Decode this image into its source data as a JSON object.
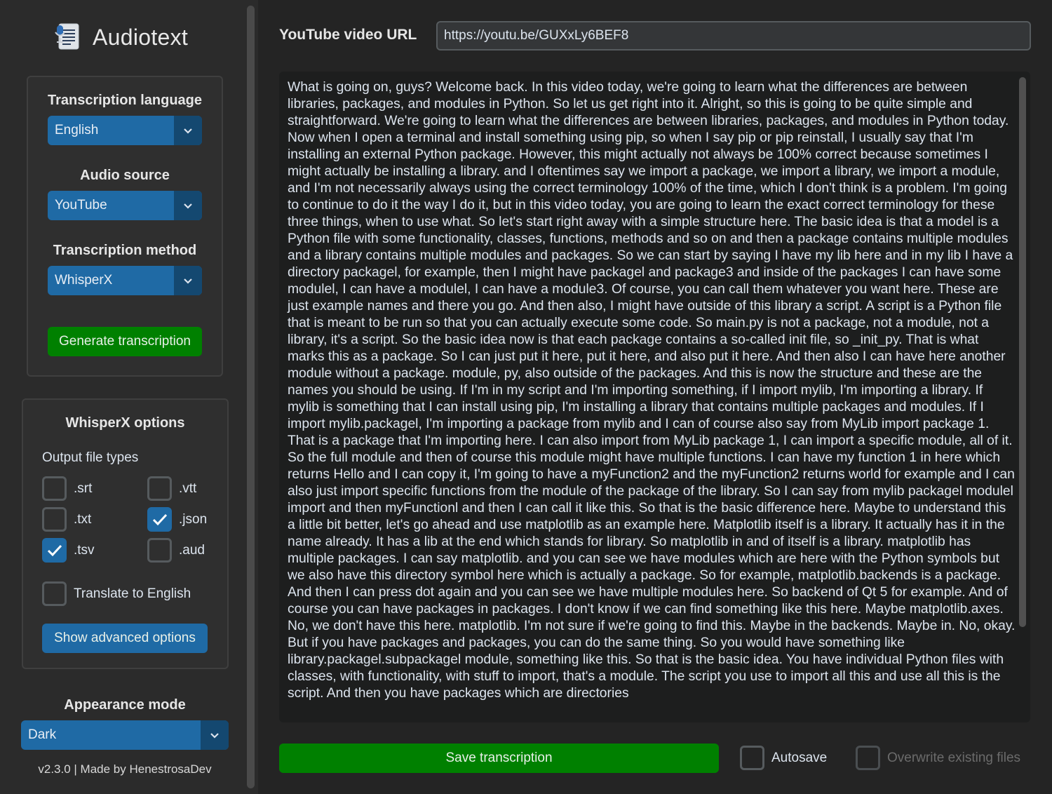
{
  "app": {
    "title": "Audiotext",
    "version_text": "v2.3.0 | Made by HenestrosaDev"
  },
  "colors": {
    "accent_blue": "#1f6aa5",
    "dark_blue": "#144870",
    "green": "#008000",
    "bg": "#242424",
    "sidebar": "#2b2b2b"
  },
  "sidebar": {
    "transcription_language": {
      "label": "Transcription language",
      "value": "English"
    },
    "audio_source": {
      "label": "Audio source",
      "value": "YouTube"
    },
    "transcription_method": {
      "label": "Transcription method",
      "value": "WhisperX"
    },
    "generate_button": "Generate transcription",
    "whisperx": {
      "title": "WhisperX options",
      "output_label": "Output file types",
      "types": {
        "srt": {
          "label": ".srt",
          "checked": false
        },
        "vtt": {
          "label": ".vtt",
          "checked": false
        },
        "txt": {
          "label": ".txt",
          "checked": false
        },
        "json": {
          "label": ".json",
          "checked": true
        },
        "tsv": {
          "label": ".tsv",
          "checked": true
        },
        "aud": {
          "label": ".aud",
          "checked": false
        }
      },
      "translate_label": "Translate to English",
      "advanced_button": "Show advanced options"
    },
    "appearance": {
      "label": "Appearance mode",
      "value": "Dark"
    }
  },
  "main": {
    "url_label": "YouTube video URL",
    "url_value": "https://youtu.be/GUXxLy6BEF8",
    "transcript": "What is going on, guys? Welcome back. In this video today, we're going to learn what the differences are between libraries, packages, and modules in Python. So let us get right into it. Alright, so this is going to be quite simple and straightforward. We're going to learn what the differences are between libraries, packages, and modules in Python today. Now when I open a terminal and install something using pip, so when I say pip or pip reinstall, I usually say that I'm installing an external Python package. However, this might actually not always be 100% correct because sometimes I might actually be installing a library. and I oftentimes say we import a package, we import a library, we import a module, and I'm not necessarily always using the correct terminology 100% of the time, which I don't think is a problem. I'm going to continue to do it the way I do it, but in this video today, you are going to learn the exact correct terminology for these three things, when to use what. So let's start right away with a simple structure here. The basic idea is that a model is a Python file with some functionality, classes, functions, methods and so on and then a package contains multiple modules and a library contains multiple modules and packages. So we can start by saying I have my lib here and in my lib I have a directory packagel, for example, then I might have packagel and package3 and inside of the packages I can have some modulel, I can have a modulel, I can have a module3. Of course, you can call them whatever you want here. These are just example names and there you go. And then also, I might have outside of this library a script. A script is a Python file that is meant to be run so that you can actually execute some code. So main.py is not a package, not a module, not a library, it's a script. So the basic idea now is that each package contains a so-called init file, so _init_py. That is what marks this as a package. So I can just put it here, put it here, and also put it here. And then also I can have here another module without a package. module, py, also outside of the packages. And this is now the structure and these are the names you should be using. If I'm in my script and I'm importing something, if I import mylib, I'm importing a library. If mylib is something that I can install using pip, I'm installing a library that contains multiple packages and modules. If I import mylib.packagel, I'm importing a package from mylib and I can of course also say from MyLib import package 1. That is a package that I'm importing here. I can also import from MyLib package 1, I can import a specific module, all of it. So the full module and then of course this module might have multiple functions. I can have my function 1 in here which returns Hello and I can copy it, I'm going to have a myFunction2 and the myFunction2 returns world for example and I can also just import specific functions from the module of the package of the library. So I can say from mylib packagel modulel import and then myFunctionl and then I can call it like this. So that is the basic difference here. Maybe to understand this a little bit better, let's go ahead and use matplotlib as an example here. Matplotlib itself is a library. It actually has it in the name already. It has a lib at the end which stands for library. So matplotlib in and of itself is a library. matplotlib has multiple packages. I can say matplotlib. and you can see we have modules which are here with the Python symbols but we also have this directory symbol here which is actually a package. So for example, matplotlib.backends is a package. And then I can press dot again and you can see we have multiple modules here. So backend of Qt 5 for example. And of course you can have packages in packages. I don't know if we can find something like this here. Maybe matplotlib.axes. No, we don't have this here. matplotlib. I'm not sure if we're going to find this. Maybe in the backends. Maybe in. No, okay. But if you have packages and packages, you can do the same thing. So you would have something like library.packagel.subpackagel module, something like this. So that is the basic idea. You have individual Python files with classes, with functionality, with stuff to import, that's a module. The script you use to import all this and use all this is the script. And then you have packages which are directories",
    "save_button": "Save transcription",
    "autosave_label": "Autosave",
    "overwrite_label": "Overwrite existing files"
  },
  "icons": {
    "logo": "audiotext-logo-icon",
    "dropdown": "chevron-down-icon",
    "check": "checkmark-icon"
  }
}
